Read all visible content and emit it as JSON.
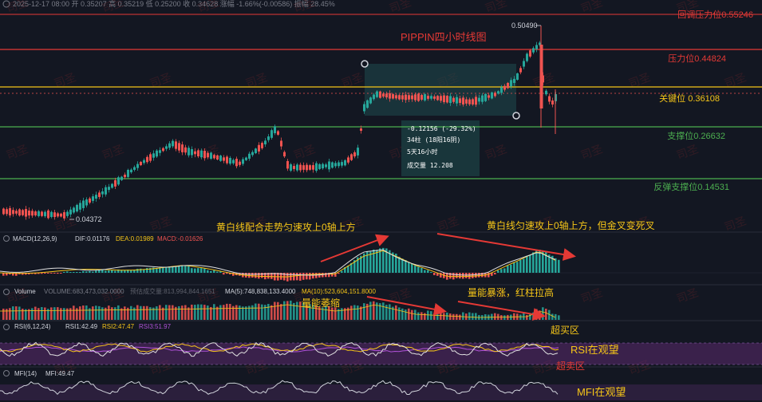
{
  "header": {
    "ohlc_line": "2025-12-17 08:00  开 0.35207  高 0.35219  低 0.25200  收 0.34628  涨幅 -1.66%(-0.00586)  振幅 28.45%"
  },
  "chart": {
    "title": "PIPPIN四小时线图",
    "high_marker": "0.50490",
    "low_marker": "0.04372",
    "levels": [
      {
        "label": "回调压力位0.55246",
        "color": "#e53935"
      },
      {
        "label": "压力位0.44824",
        "color": "#e53935"
      },
      {
        "label": "关键位 0.36108",
        "color": "#f5c518"
      },
      {
        "label": "支撑位0.26632",
        "color": "#4caf50"
      },
      {
        "label": "反弹支撑位0.14531",
        "color": "#4caf50"
      }
    ],
    "measure": {
      "change": "-0.12156 (-29.32%)",
      "bars": "34柱 (18阳16阴)",
      "duration": "5天16小时",
      "volume": "成交量 12.208"
    },
    "watermark": "司圣"
  },
  "macd": {
    "title": "MACD(12,26,9)",
    "dif": "DIF:0.01176",
    "dea": "DEA:0.01989",
    "macd": "MACD:-0.01626",
    "note_left": "黄白线配合走势匀速攻上0轴上方",
    "note_right": "黄白线匀速攻上0轴上方，但金叉变死叉"
  },
  "volume": {
    "title": "Volume",
    "volume": "VOLUME:683,473,032.0000",
    "forecast": "预估成交量:813,994,844.1651",
    "ma5": "MA(5):748,838,133.4000",
    "ma10": "MA(10):523,604,151.8000",
    "note_left": "量能萎缩",
    "note_right": "量能暴涨，红柱拉高"
  },
  "rsi": {
    "title": "RSI(6,12,24)",
    "rsi1": "RSI1:42.49",
    "rsi2": "RSI2:47.47",
    "rsi3": "RSI3:51.97",
    "overbought": "超买区",
    "oversold": "超卖区",
    "note": "RSI在观望"
  },
  "mfi": {
    "title": "MFI(14)",
    "value": "MFI:49.47",
    "note": "MFI在观望"
  },
  "colors": {
    "background": "#131722",
    "up": "#26a69a",
    "down": "#ef5350",
    "dif_line": "#e0e0e0",
    "dea_line": "#f5c518",
    "rsi3": "#b052d8"
  }
}
